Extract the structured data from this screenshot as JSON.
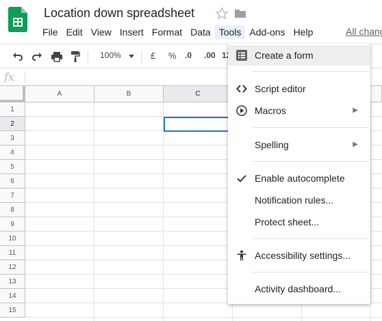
{
  "doc": {
    "title": "Location down spreadsheet",
    "star_icon": "star-outline-icon",
    "folder_icon": "folder-icon"
  },
  "menu": [
    "File",
    "Edit",
    "View",
    "Insert",
    "Format",
    "Data",
    "Tools",
    "Add-ons",
    "Help"
  ],
  "last_edit": "All chang",
  "toolbar": {
    "zoom": "100%",
    "currency": "£",
    "percent": "%",
    "dec_less": ".0",
    "dec_more": ".00",
    "more_formats": "12"
  },
  "formula": {
    "fx": "fx"
  },
  "columns": [
    "A",
    "B",
    "C"
  ],
  "rows": [
    "1",
    "2",
    "3",
    "4",
    "5",
    "6",
    "7",
    "8",
    "9",
    "10",
    "11",
    "12",
    "13",
    "14",
    "15"
  ],
  "tools_menu": {
    "items": [
      {
        "label": "Create a form",
        "icon": "form-icon"
      },
      {
        "label": "Script editor",
        "icon": "code-icon"
      },
      {
        "label": "Macros",
        "icon": "play-circle-icon",
        "submenu": true
      },
      {
        "label": "Spelling",
        "submenu": true
      },
      {
        "label": "Enable autocomplete",
        "icon": "check-icon",
        "checked": true
      },
      {
        "label": "Notification rules..."
      },
      {
        "label": "Protect sheet..."
      },
      {
        "label": "Accessibility settings...",
        "icon": "accessibility-icon"
      },
      {
        "label": "Activity dashboard..."
      }
    ],
    "submenu_arrow": "▶"
  },
  "colors": {
    "accent": "#1a73e8",
    "sheets_green": "#0f9d58",
    "menu_highlight": "#eeeeee"
  }
}
